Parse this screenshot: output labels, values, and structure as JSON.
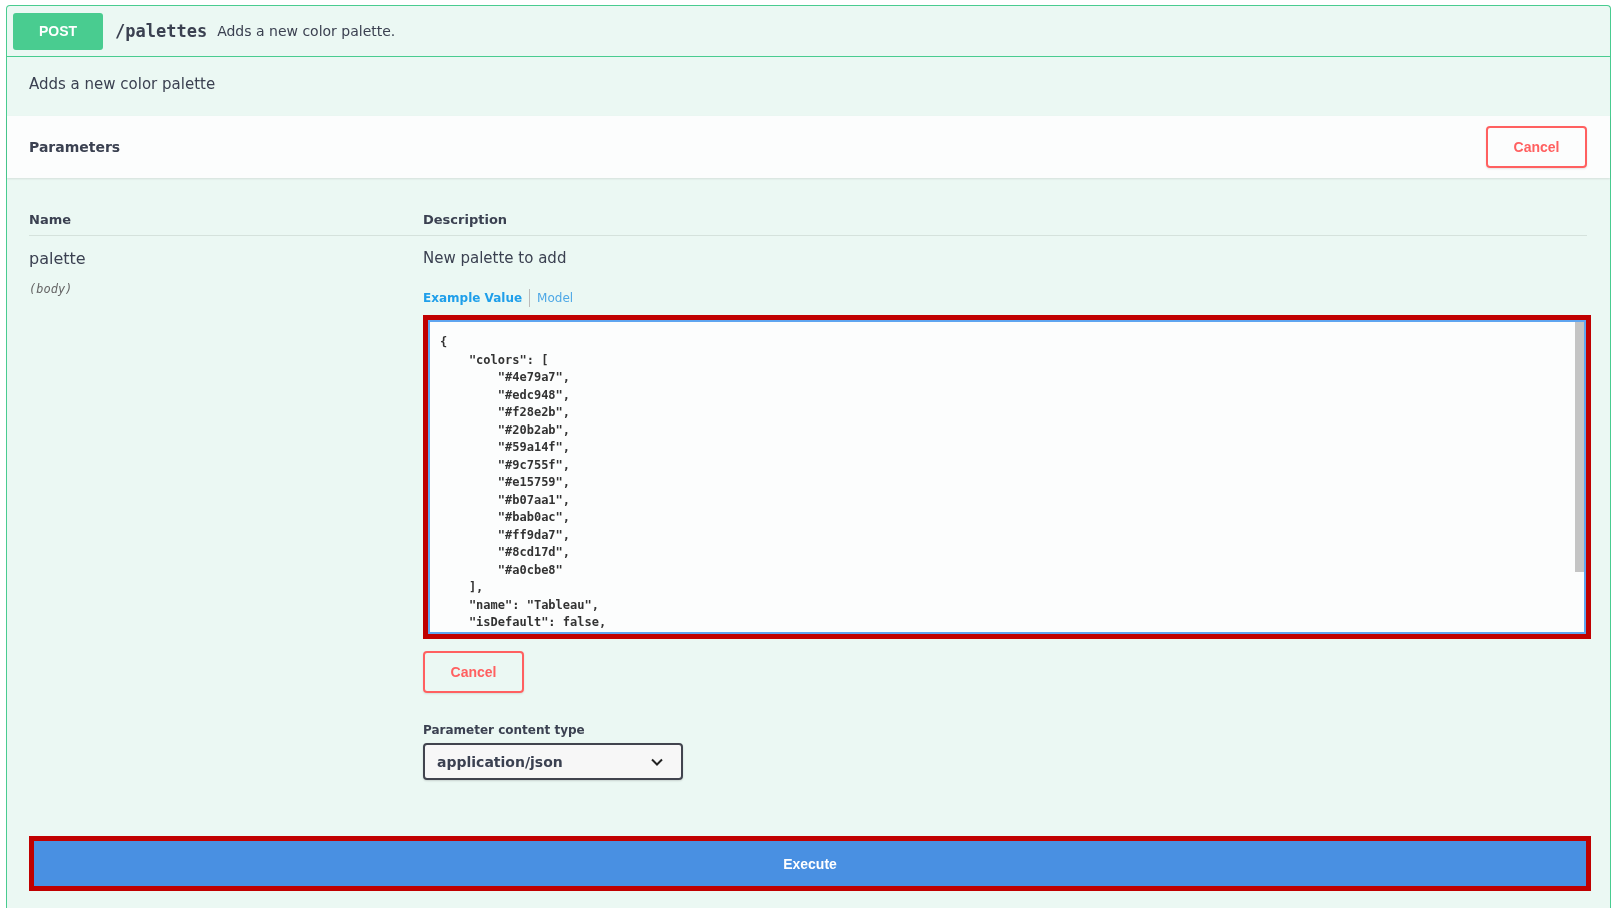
{
  "operation": {
    "method": "POST",
    "path": "/palettes",
    "summary": "Adds a new color palette."
  },
  "description": "Adds a new color palette",
  "parameters_section": {
    "title": "Parameters",
    "cancel_button": "Cancel"
  },
  "table": {
    "columns": [
      "Name",
      "Description"
    ],
    "rows": [
      {
        "name": "palette",
        "location": "(body)",
        "description": "New palette to add",
        "tabs": [
          {
            "label": "Example Value",
            "selected": true
          },
          {
            "label": "Model",
            "selected": false
          }
        ],
        "body_value": "{\n    \"colors\": [\n        \"#4e79a7\",\n        \"#edc948\",\n        \"#f28e2b\",\n        \"#20b2ab\",\n        \"#59a14f\",\n        \"#9c755f\",\n        \"#e15759\",\n        \"#b07aa1\",\n        \"#bab0ac\",\n        \"#ff9da7\",\n        \"#8cd17d\",\n        \"#a0cbe8\"\n    ],\n    \"name\": \"Tableau\",\n    \"isDefault\": false,",
        "cancel_button": "Cancel",
        "content_type": {
          "label": "Parameter content type",
          "value": "application/json"
        }
      }
    ]
  },
  "execute_button": "Execute"
}
